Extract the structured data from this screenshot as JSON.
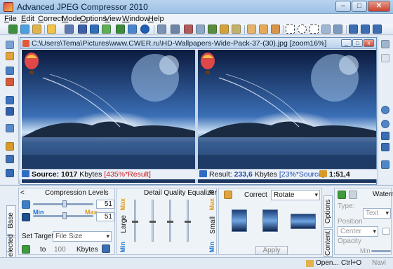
{
  "window": {
    "title": "Advanced JPEG Compressor 2010",
    "minimize": "–",
    "maximize": "□",
    "close": "✕"
  },
  "menu": [
    "File",
    "Edit",
    "Correct",
    "Mode",
    "Options",
    "View",
    "Window",
    "Help"
  ],
  "image_window": {
    "path": "C:\\Users\\Tema\\Pictures\\www.CWER.ru\\HD-Wallpapers-Wide-Pack-37-(30).jpg [zoom16%]",
    "buttons": [
      "_",
      "□",
      "x"
    ]
  },
  "status": {
    "source_prefix": "Source:",
    "source_value": "1017",
    "source_unit": "Kbytes",
    "source_ratio": "[435%*Result]",
    "result_prefix": "Result:",
    "result_value": "233,6",
    "result_unit": "Kbytes",
    "result_ratio": "[23%*Source]",
    "ratio": "1:51,4"
  },
  "bottom": {
    "tabs_left": [
      "Base",
      "Selected"
    ],
    "compression_levels": "Compression Levels",
    "min": "Min",
    "max": "Max",
    "level1": "51",
    "level2": "51",
    "set_target": "Set Target",
    "target_mode": "File Size",
    "to": "to",
    "target_value": "100",
    "target_unit": "Kbytes",
    "equalizer_title": "Detail Quality Equalizer",
    "eq_r": "R",
    "eq_large": "Large",
    "eq_small": "Small",
    "eq_max": "Max",
    "eq_min": "Min",
    "correct": "Correct",
    "correct_mode": "Rotate",
    "apply": "Apply",
    "tabs_right": [
      "Options",
      "Content"
    ],
    "watermark": "Waterm",
    "type_label": "Type:",
    "type_value": "Text",
    "position_label": "Position",
    "position_value": "Center",
    "opacity_label": "Opacity",
    "opacity_min": "Min"
  },
  "footer": {
    "open": "Open...",
    "shortcut": "Ctrl+O",
    "nav": "Navi"
  }
}
